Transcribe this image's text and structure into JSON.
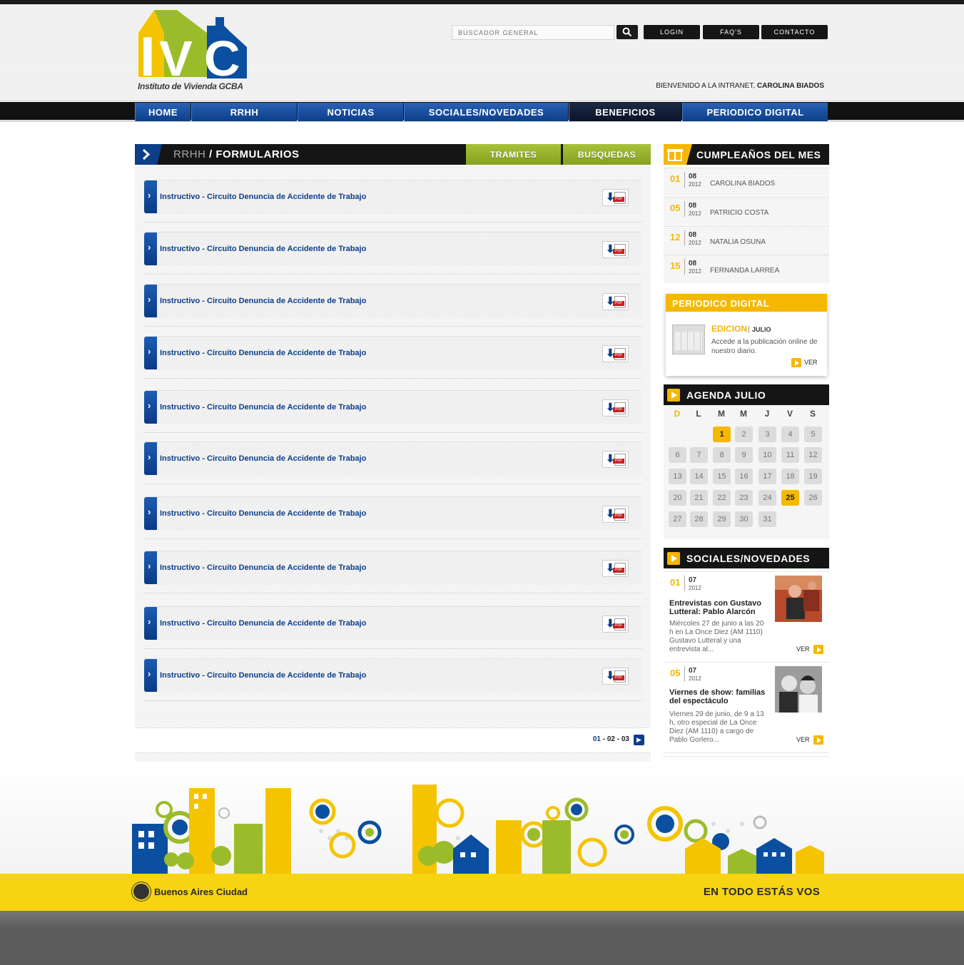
{
  "header": {
    "logo_subtitle": "Instituto de Vivienda GCBA",
    "search_placeholder": "BUSCADOR GENERAL",
    "buttons": {
      "login": "LOGIN",
      "faqs": "FAQ'S",
      "contacto": "CONTACTO"
    },
    "welcome_text": "BIENVENIDO A LA INTRANET, ",
    "welcome_user": "CAROLINA BIADOS"
  },
  "nav": [
    "HOME",
    "RRHH",
    "NOTICIAS",
    "SOCIALES/NOVEDADES",
    "BENEFICIOS",
    "PERIODICO DIGITAL"
  ],
  "main": {
    "section": "RRHH",
    "title_sep": " / ",
    "subsection": "FORMULARIOS",
    "tabs": [
      "TRAMITES",
      "BUSQUEDAS"
    ],
    "items": [
      {
        "label": "Instructivo - Circuito Denuncia de Accidente de Trabajo",
        "file": "PDF"
      },
      {
        "label": "Instructivo - Circuito Denuncia de Accidente de Trabajo",
        "file": "PDF"
      },
      {
        "label": "Instructivo - Circuito Denuncia de Accidente de Trabajo",
        "file": "PDF"
      },
      {
        "label": "Instructivo - Circuito Denuncia de Accidente de Trabajo",
        "file": "PDF"
      },
      {
        "label": "Instructivo - Circuito Denuncia de Accidente de Trabajo",
        "file": "PDF"
      },
      {
        "label": "Instructivo - Circuito Denuncia de Accidente de Trabajo",
        "file": "PDF"
      },
      {
        "label": "Instructivo - Circuito Denuncia de Accidente de Trabajo",
        "file": "PDF"
      },
      {
        "label": "Instructivo - Circuito Denuncia de Accidente de Trabajo",
        "file": "PDF"
      },
      {
        "label": "Instructivo - Circuito Denuncia de Accidente de Trabajo",
        "file": "PDF"
      },
      {
        "label": "Instructivo - Circuito Denuncia de Accidente de Trabajo",
        "file": "PDF"
      }
    ],
    "pagination": {
      "current": "01",
      "sep1": " - ",
      "p2": "02",
      "sep2": " - ",
      "p3": "03"
    }
  },
  "birthdays": {
    "title": "CUMPLEAÑOS DEL MES",
    "items": [
      {
        "day": "01",
        "month": "08",
        "year": "2012",
        "name": "CAROLINA BIADOS"
      },
      {
        "day": "05",
        "month": "08",
        "year": "2012",
        "name": "PATRICIO COSTA"
      },
      {
        "day": "12",
        "month": "08",
        "year": "2012",
        "name": "NATALIA OSUNA"
      },
      {
        "day": "15",
        "month": "08",
        "year": "2012",
        "name": "FERNANDA LARREA"
      }
    ]
  },
  "periodico": {
    "title": "PERIODICO DIGITAL",
    "edition_label": "EDICION",
    "edition_month": "JULIO",
    "description": "Accede a la publicación online de nuestro diario.",
    "ver": "VER"
  },
  "agenda": {
    "title": "AGENDA JULIO",
    "weekdays": [
      "D",
      "L",
      "M",
      "M",
      "J",
      "V",
      "S"
    ],
    "days": [
      "1",
      "2",
      "3",
      "4",
      "5",
      "6",
      "7",
      "8",
      "9",
      "10",
      "11",
      "12",
      "13",
      "14",
      "15",
      "16",
      "17",
      "18",
      "19",
      "20",
      "21",
      "22",
      "23",
      "24",
      "25",
      "26",
      "27",
      "28",
      "29",
      "30",
      "31"
    ],
    "highlighted": [
      "1",
      "25"
    ],
    "first_weekday_index": 2
  },
  "sociales": {
    "title": "SOCIALES/NOVEDADES",
    "items": [
      {
        "day": "01",
        "month": "07",
        "year": "2012",
        "title": "Entrevistas con Gustavo Lutteral: Pablo Alarcón",
        "text": "Miércoles 27 de junio a las 20 h en La Once Diez (AM 1110) Gustavo Lutteral y una entrevista al...",
        "ver": "VER"
      },
      {
        "day": "05",
        "month": "07",
        "year": "2012",
        "title": "Viernes de show: familias del espectáculo",
        "text": "Viernes 29 de junio, de 9 a 13 h, otro especial de La Once Diez (AM 1110) a cargo de Pablo Gorlero...",
        "ver": "VER"
      }
    ]
  },
  "footer": {
    "city_name": "Buenos Aires Ciudad",
    "slogan": "EN TODO ESTÁS VOS"
  },
  "colors": {
    "blue": "#0c3e8a",
    "yellow": "#f5b800",
    "green": "#a9c13a",
    "footer_yellow": "#f7d312"
  }
}
